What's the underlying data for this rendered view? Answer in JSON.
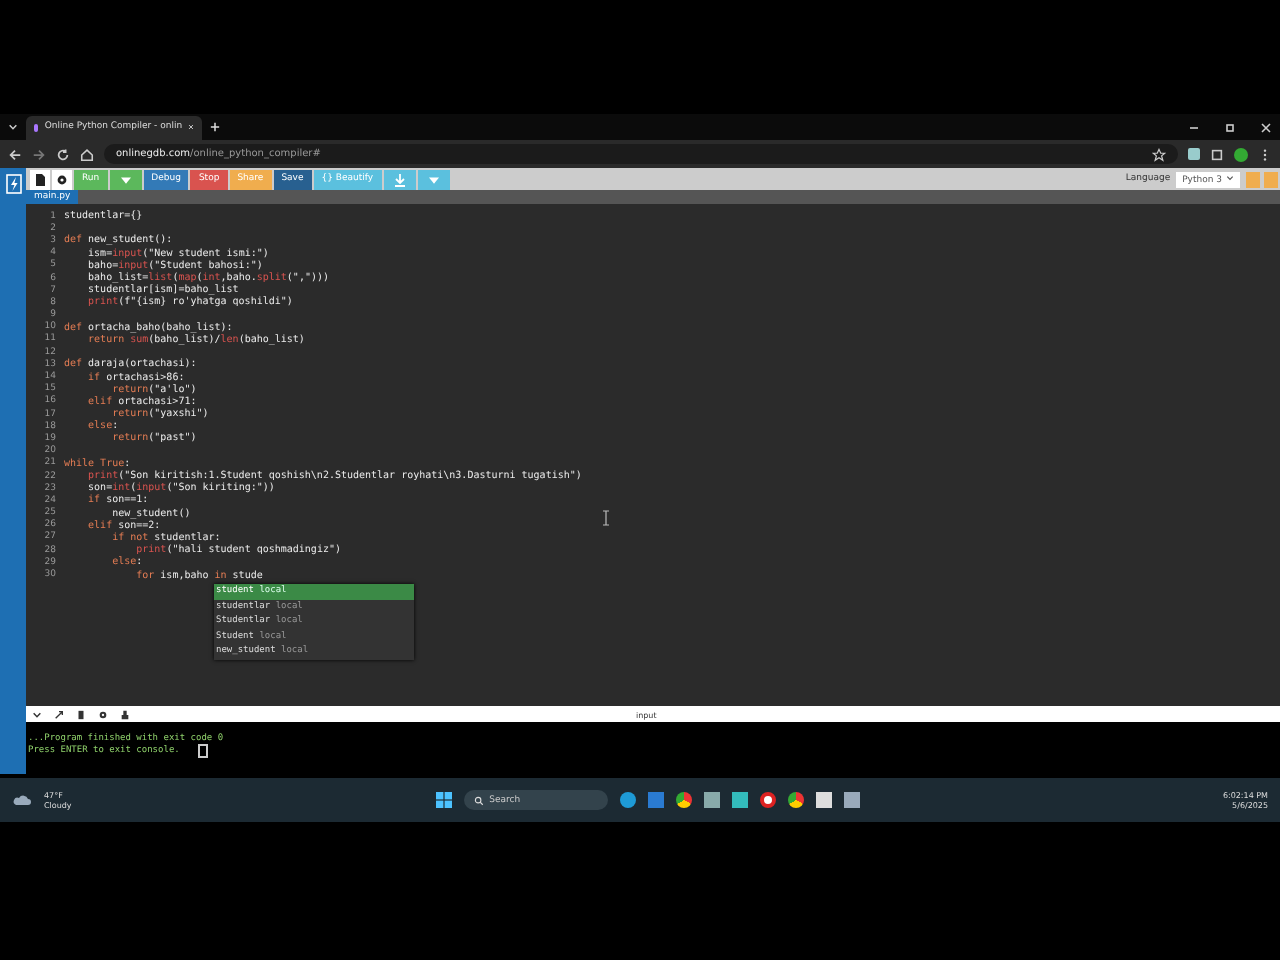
{
  "browser": {
    "tab_title": "Online Python Compiler - onlin",
    "url_domain": "onlinegdb.com",
    "url_path": "/online_python_compiler#"
  },
  "toolbar": {
    "buttons": [
      {
        "kind": "run",
        "label": "Run"
      },
      {
        "kind": "debug",
        "label": "Debug"
      },
      {
        "kind": "stop",
        "label": "Stop"
      },
      {
        "kind": "share",
        "label": "Share"
      },
      {
        "kind": "save",
        "label": "Save"
      },
      {
        "kind": "beautify",
        "label": "{} Beautify"
      }
    ],
    "language_label": "Language",
    "language": "Python 3"
  },
  "file_tab": "main.py",
  "code_lines": [
    {
      "num": "1",
      "segments": [
        {
          "text": "studentlar={}",
          "kind": "plain"
        }
      ]
    },
    {
      "num": "2"
    },
    {
      "num": "3",
      "segments": [
        {
          "text": "def ",
          "kind": "kw"
        },
        {
          "text": "new_student():",
          "kind": "plain"
        }
      ]
    },
    {
      "num": "4",
      "segments": [
        {
          "text": "    ism=",
          "kind": "plain"
        },
        {
          "text": "input",
          "kind": "builtin"
        },
        {
          "text": "(\"New student ismi:\")",
          "kind": "plain"
        }
      ]
    },
    {
      "num": "5",
      "segments": [
        {
          "text": "    baho=",
          "kind": "plain"
        },
        {
          "text": "input",
          "kind": "builtin"
        },
        {
          "text": "(\"Student bahosi:\")",
          "kind": "plain"
        }
      ]
    },
    {
      "num": "6",
      "segments": [
        {
          "text": "    baho_list=",
          "kind": "plain"
        },
        {
          "text": "list",
          "kind": "builtin"
        },
        {
          "text": "(",
          "kind": "plain"
        },
        {
          "text": "map",
          "kind": "builtin"
        },
        {
          "text": "(",
          "kind": "plain"
        },
        {
          "text": "int",
          "kind": "builtin"
        },
        {
          "text": ",baho.",
          "kind": "plain"
        },
        {
          "text": "split",
          "kind": "builtin"
        },
        {
          "text": "(\",\")))",
          "kind": "plain"
        }
      ]
    },
    {
      "num": "7",
      "segments": [
        {
          "text": "    studentlar[ism]=baho_list",
          "kind": "plain"
        }
      ]
    },
    {
      "num": "8",
      "segments": [
        {
          "text": "    print",
          "kind": "builtin"
        },
        {
          "text": "(f\"{ism} ro'yhatga qoshildi\")",
          "kind": "plain"
        }
      ]
    },
    {
      "num": "9"
    },
    {
      "num": "10",
      "segments": [
        {
          "text": "def ",
          "kind": "kw"
        },
        {
          "text": "ortacha_baho(baho_list):",
          "kind": "plain"
        }
      ]
    },
    {
      "num": "11",
      "segments": [
        {
          "text": "    return ",
          "kind": "kw"
        },
        {
          "text": "sum",
          "kind": "builtin"
        },
        {
          "text": "(baho_list)/",
          "kind": "plain"
        },
        {
          "text": "len",
          "kind": "builtin"
        },
        {
          "text": "(baho_list)",
          "kind": "plain"
        }
      ]
    },
    {
      "num": "12"
    },
    {
      "num": "13",
      "segments": [
        {
          "text": "def ",
          "kind": "kw"
        },
        {
          "text": "daraja(ortachasi):",
          "kind": "plain"
        }
      ]
    },
    {
      "num": "14",
      "segments": [
        {
          "text": "    if ",
          "kind": "kw"
        },
        {
          "text": "ortachasi>86:",
          "kind": "plain"
        }
      ]
    },
    {
      "num": "15",
      "segments": [
        {
          "text": "        return",
          "kind": "kw"
        },
        {
          "text": "(\"a'lo\")",
          "kind": "plain"
        }
      ]
    },
    {
      "num": "16",
      "segments": [
        {
          "text": "    elif ",
          "kind": "kw"
        },
        {
          "text": "ortachasi>71:",
          "kind": "plain"
        }
      ]
    },
    {
      "num": "17",
      "segments": [
        {
          "text": "        return",
          "kind": "kw"
        },
        {
          "text": "(\"yaxshi\")",
          "kind": "plain"
        }
      ]
    },
    {
      "num": "18",
      "segments": [
        {
          "text": "    else",
          "kind": "kw"
        },
        {
          "text": ":",
          "kind": "plain"
        }
      ]
    },
    {
      "num": "19",
      "segments": [
        {
          "text": "        return",
          "kind": "kw"
        },
        {
          "text": "(\"past\")",
          "kind": "plain"
        }
      ]
    },
    {
      "num": "20"
    },
    {
      "num": "21",
      "segments": [
        {
          "text": "while True",
          "kind": "kw"
        },
        {
          "text": ":",
          "kind": "plain"
        }
      ]
    },
    {
      "num": "22",
      "segments": [
        {
          "text": "    print",
          "kind": "builtin"
        },
        {
          "text": "(\"Son kiritish:1.Student qoshish\\n2.Studentlar royhati\\n3.Dasturni tugatish\")",
          "kind": "plain"
        }
      ]
    },
    {
      "num": "23",
      "segments": [
        {
          "text": "    son=",
          "kind": "plain"
        },
        {
          "text": "int",
          "kind": "builtin"
        },
        {
          "text": "(",
          "kind": "plain"
        },
        {
          "text": "input",
          "kind": "builtin"
        },
        {
          "text": "(\"Son kiriting:\"))",
          "kind": "plain"
        }
      ]
    },
    {
      "num": "24",
      "segments": [
        {
          "text": "    if ",
          "kind": "kw"
        },
        {
          "text": "son==1:",
          "kind": "plain"
        }
      ]
    },
    {
      "num": "25",
      "segments": [
        {
          "text": "        new_student()",
          "kind": "plain"
        }
      ]
    },
    {
      "num": "26",
      "segments": [
        {
          "text": "    elif ",
          "kind": "kw"
        },
        {
          "text": "son==2:",
          "kind": "plain"
        }
      ]
    },
    {
      "num": "27",
      "segments": [
        {
          "text": "        if not ",
          "kind": "kw"
        },
        {
          "text": "studentlar:",
          "kind": "plain"
        }
      ]
    },
    {
      "num": "28",
      "segments": [
        {
          "text": "            print",
          "kind": "builtin"
        },
        {
          "text": "(\"hali student qoshmadingiz\")",
          "kind": "plain"
        }
      ]
    },
    {
      "num": "29",
      "segments": [
        {
          "text": "        else",
          "kind": "kw"
        },
        {
          "text": ":",
          "kind": "plain"
        }
      ]
    },
    {
      "num": "30",
      "segments": [
        {
          "text": "            for ",
          "kind": "kw"
        },
        {
          "text": "ism,baho ",
          "kind": "plain"
        },
        {
          "text": "in ",
          "kind": "kw"
        },
        {
          "text": "stude",
          "kind": "plain"
        }
      ]
    }
  ],
  "autocomplete": [
    {
      "word": "student",
      "scope": "local",
      "selected": true
    },
    {
      "word": "studentlar",
      "scope": "local",
      "selected": false
    },
    {
      "word": "Studentlar",
      "scope": "local",
      "selected": false
    },
    {
      "word": "Student",
      "scope": "local",
      "selected": false
    },
    {
      "word": "new_student",
      "scope": "local",
      "selected": false
    }
  ],
  "output": {
    "label": "input",
    "lines": [
      "...Program finished with exit code 0",
      "Press ENTER to exit console."
    ]
  },
  "taskbar": {
    "temperature": "47°F",
    "weather": "Cloudy",
    "search_placeholder": "Search",
    "time": "6:02:14 PM",
    "date": "5/6/2025"
  }
}
